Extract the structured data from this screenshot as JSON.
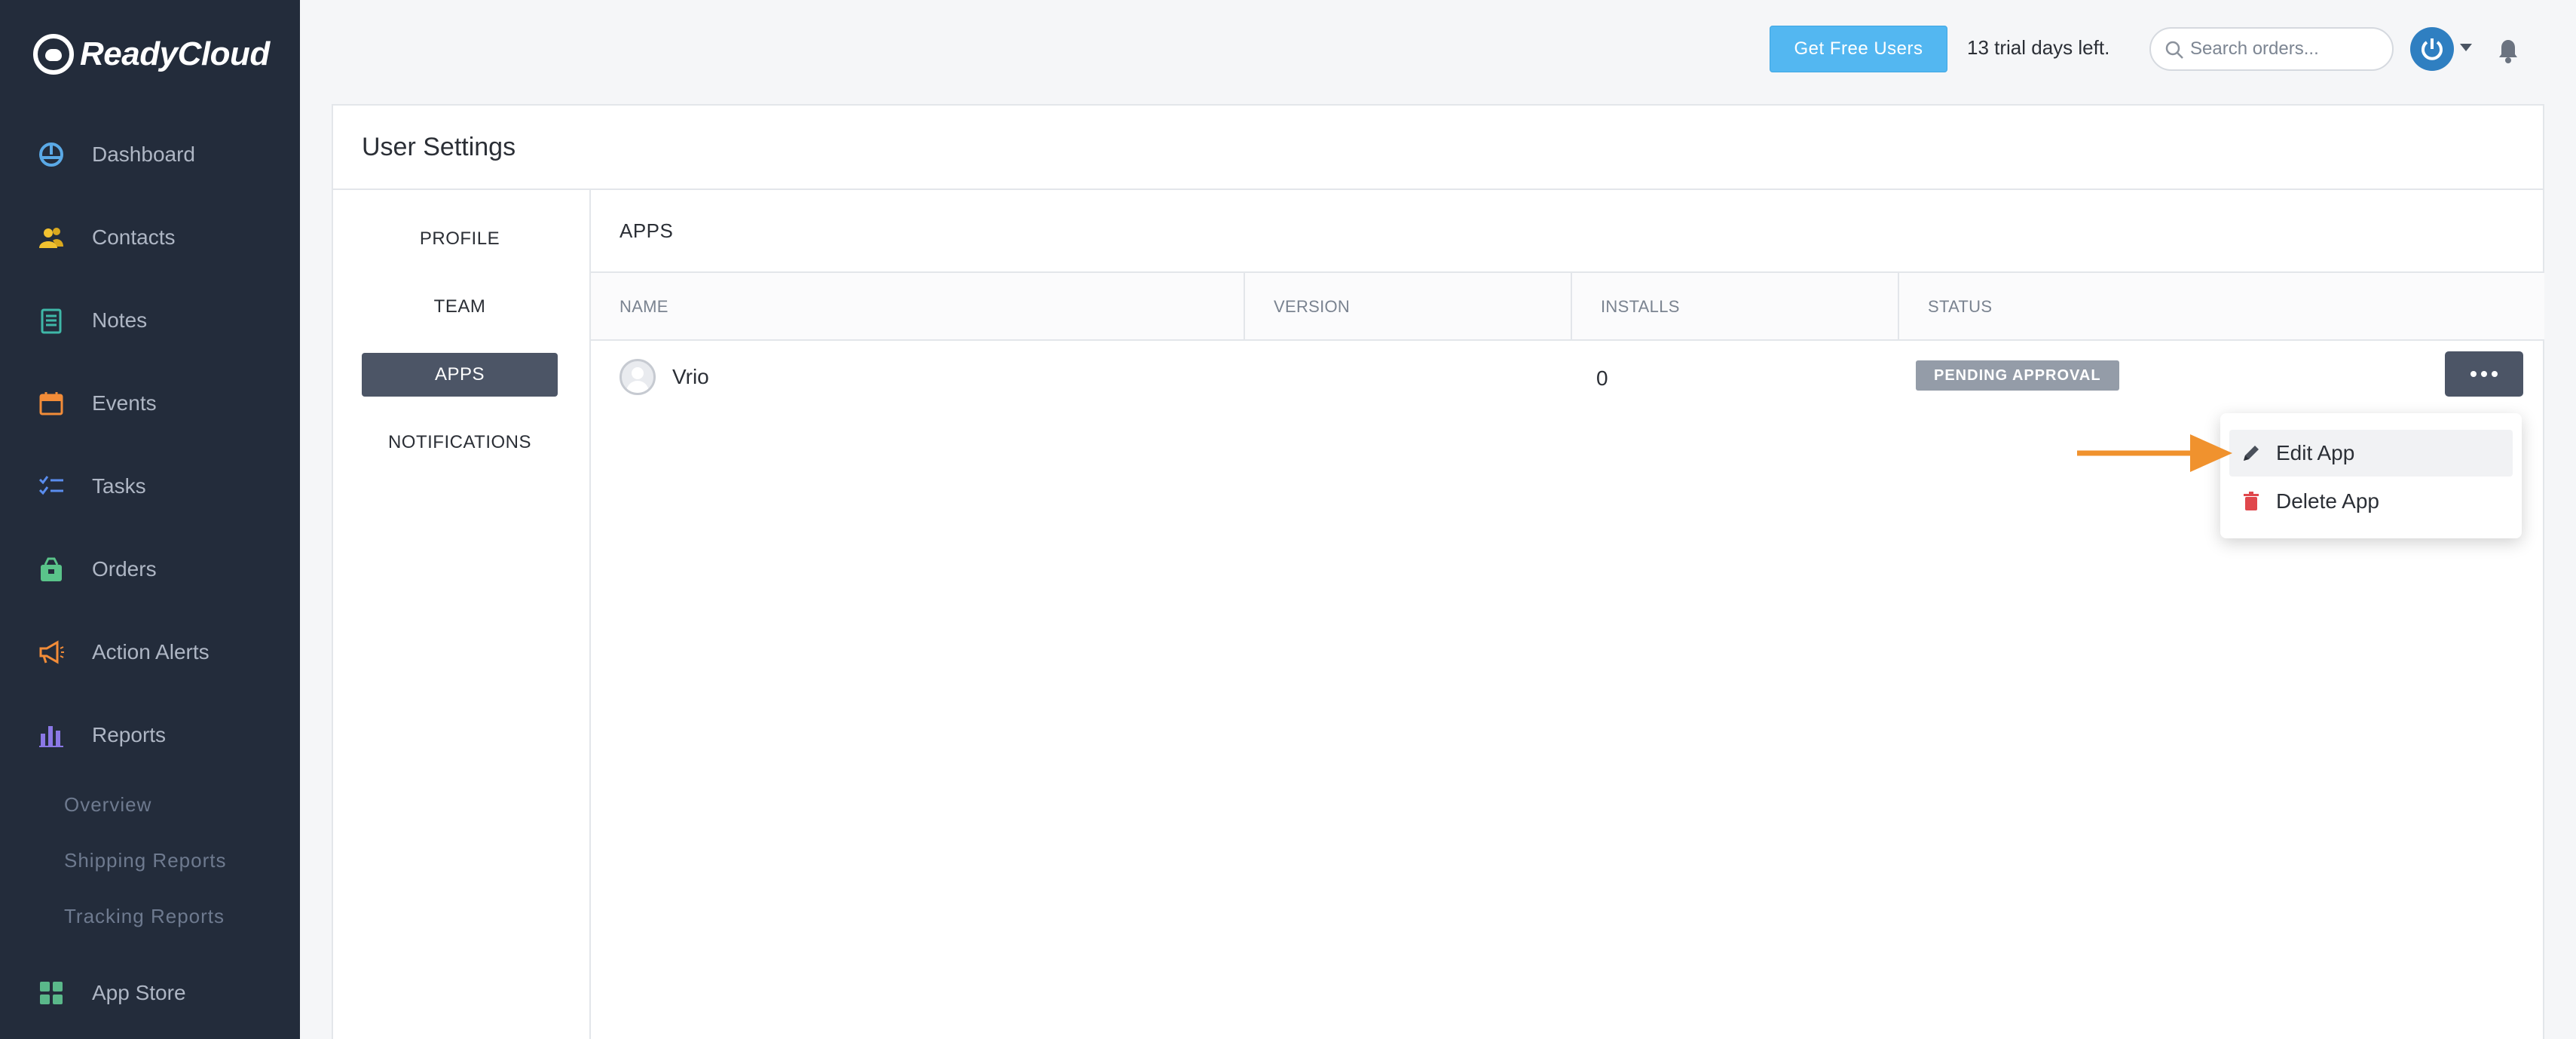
{
  "brand": {
    "name": "ReadyCloud"
  },
  "sidebar": {
    "items": [
      {
        "label": "Dashboard",
        "icon": "dashboard-icon",
        "color": "#5aa9e6"
      },
      {
        "label": "Contacts",
        "icon": "contacts-icon",
        "color": "#f2c230"
      },
      {
        "label": "Notes",
        "icon": "notes-icon",
        "color": "#3fb8a8"
      },
      {
        "label": "Events",
        "icon": "calendar-icon",
        "color": "#f28c38"
      },
      {
        "label": "Tasks",
        "icon": "tasks-icon",
        "color": "#5a8dee"
      },
      {
        "label": "Orders",
        "icon": "orders-icon",
        "color": "#5ac48a"
      },
      {
        "label": "Action Alerts",
        "icon": "megaphone-icon",
        "color": "#f28c38"
      },
      {
        "label": "Reports",
        "icon": "reports-icon",
        "color": "#8b78e6"
      }
    ],
    "reports_sub": [
      "Overview",
      "Shipping Reports",
      "Tracking Reports"
    ],
    "app_store": {
      "label": "App Store",
      "icon": "app-store-icon",
      "color": "#5ab88a"
    }
  },
  "topbar": {
    "get_free_users": "Get Free Users",
    "trial_text": "13 trial days left.",
    "search_placeholder": "Search orders..."
  },
  "panel": {
    "title": "User Settings",
    "subnav": [
      "PROFILE",
      "TEAM",
      "APPS",
      "NOTIFICATIONS"
    ],
    "active_subnav": "APPS",
    "section_title": "APPS",
    "columns": [
      "NAME",
      "VERSION",
      "INSTALLS",
      "STATUS"
    ],
    "rows": [
      {
        "name": "Vrio",
        "version": "",
        "installs": "0",
        "status": "PENDING APPROVAL"
      }
    ]
  },
  "dropdown": {
    "items": [
      {
        "label": "Edit App",
        "icon": "pencil-icon"
      },
      {
        "label": "Delete App",
        "icon": "trash-icon"
      }
    ]
  },
  "colors": {
    "sidebar_bg": "#232c3b",
    "accent_blue": "#53b7f1",
    "active_button": "#4c5566",
    "badge": "#949ca8",
    "annotation_arrow": "#f0922e",
    "delete_red": "#e0474c"
  }
}
